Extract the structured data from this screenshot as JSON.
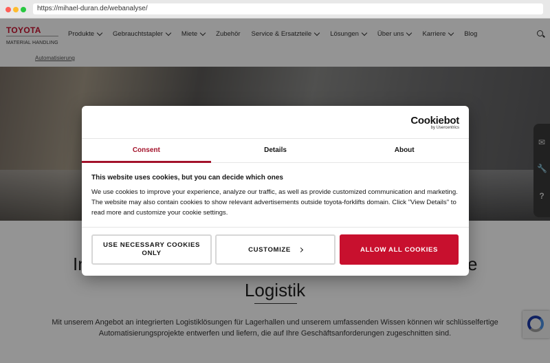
{
  "browser": {
    "url": "https://mihael-duran.de/webanalyse/"
  },
  "header": {
    "logo_top": "TOYOTA",
    "logo_bottom": "MATERIAL HANDLING",
    "nav": [
      {
        "label": "Produkte",
        "dropdown": true
      },
      {
        "label": "Gebrauchtstapler",
        "dropdown": true
      },
      {
        "label": "Miete",
        "dropdown": true
      },
      {
        "label": "Zubehör",
        "dropdown": false
      },
      {
        "label": "Service & Ersatzteile",
        "dropdown": true
      },
      {
        "label": "Lösungen",
        "dropdown": true
      },
      {
        "label": "Über uns",
        "dropdown": true
      },
      {
        "label": "Karriere",
        "dropdown": true
      },
      {
        "label": "Blog",
        "dropdown": false
      }
    ]
  },
  "breadcrumb": "Automatisierung",
  "content": {
    "heading_left": "In",
    "heading_right": "e",
    "heading_sub": "Logistik",
    "body": "Mit unserem Angebot an integrierten Logistiklösungen für Lagerhallen und unserem umfassenden Wissen können wir schlüsselfertige Automatisierungsprojekte entwerfen und liefern, die auf Ihre Geschäftsanforderungen zugeschnitten sind."
  },
  "cookie_dialog": {
    "brand": "Cookiebot",
    "brand_sub": "by Usercentrics",
    "tabs": [
      "Consent",
      "Details",
      "About"
    ],
    "active_tab": "Consent",
    "title": "This website uses cookies, but you can decide which ones",
    "text": "We use cookies to improve your experience, analyze our traffic, as well as provide customized communication and marketing. The website may also contain cookies to show relevant advertisements outside toyota-forklifts domain. Click \"View Details\" to read more and customize your cookie settings.",
    "btn_necessary": "USE NECESSARY COOKIES ONLY",
    "btn_customize": "CUSTOMIZE",
    "btn_allow": "ALLOW ALL COOKIES",
    "accent_color": "#c8102e"
  },
  "side_tools": [
    "mail-icon",
    "wrench-icon",
    "help-icon"
  ]
}
